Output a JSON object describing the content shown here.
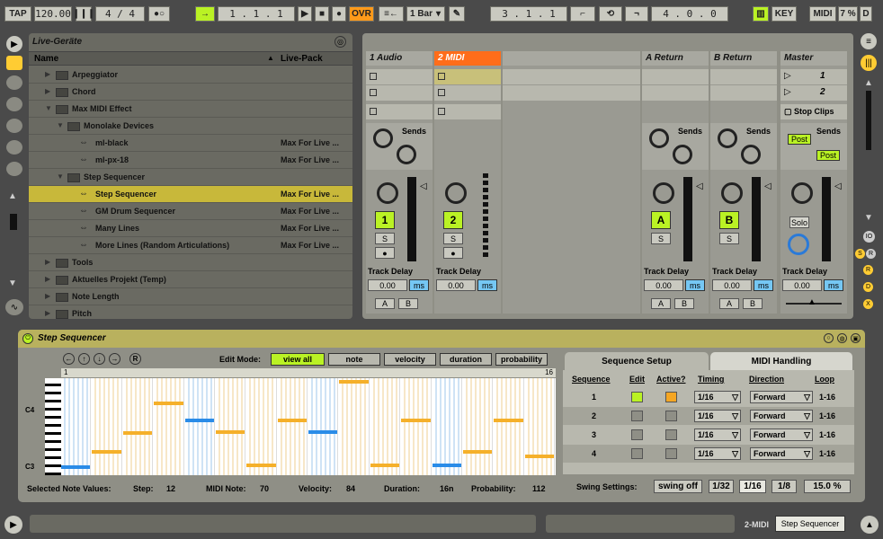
{
  "transport": {
    "tap": "TAP",
    "tempo": "120.00",
    "meter": "4 / 4",
    "position": "1 . 1 . 1",
    "ovr": "OVR",
    "quant": "1 Bar",
    "loop_start": "3 . 1 . 1",
    "loop_len": "4 . 0 . 0",
    "key": "KEY",
    "midi": "MIDI",
    "cpu": "7 %",
    "d": "D"
  },
  "browser": {
    "title": "Live-Geräte",
    "col_name": "Name",
    "col_pack": "Live-Pack",
    "items": [
      {
        "label": "Arpeggiator",
        "pack": ""
      },
      {
        "label": "Chord",
        "pack": ""
      },
      {
        "label": "Max MIDI Effect",
        "pack": ""
      },
      {
        "label": "Monolake Devices",
        "pack": ""
      },
      {
        "label": "ml-black",
        "pack": "Max For Live ..."
      },
      {
        "label": "ml-px-18",
        "pack": "Max For Live ..."
      },
      {
        "label": "Step Sequencer",
        "pack": ""
      },
      {
        "label": "Step Sequencer",
        "pack": "Max For Live ..."
      },
      {
        "label": "GM Drum Sequencer",
        "pack": "Max For Live ..."
      },
      {
        "label": "Many Lines",
        "pack": "Max For Live ..."
      },
      {
        "label": "More Lines (Random Articulations)",
        "pack": "Max For Live ..."
      },
      {
        "label": "Tools",
        "pack": ""
      },
      {
        "label": "Aktuelles Projekt (Temp)",
        "pack": ""
      },
      {
        "label": "Note Length",
        "pack": ""
      },
      {
        "label": "Pitch",
        "pack": ""
      }
    ]
  },
  "mixer": {
    "tracks": [
      {
        "name": "1 Audio",
        "num": "1",
        "delay": "0.00",
        "ms": "ms",
        "solo": "S",
        "sends": "Sends"
      },
      {
        "name": "2 MIDI",
        "num": "2",
        "delay": "0.00",
        "ms": "ms",
        "solo": "S",
        "sends": ""
      },
      {
        "name": "A Return",
        "num": "A",
        "delay": "0.00",
        "ms": "ms",
        "solo": "S",
        "sends": "Sends"
      },
      {
        "name": "B Return",
        "num": "B",
        "delay": "0.00",
        "ms": "ms",
        "solo": "S",
        "sends": "Sends"
      },
      {
        "name": "Master",
        "num": "",
        "delay": "0.00",
        "ms": "ms",
        "solo": "Solo",
        "sends": "Sends"
      }
    ],
    "track_delay": "Track Delay",
    "stop_clips": "Stop Clips",
    "post": "Post",
    "scene1": "1",
    "scene2": "2",
    "a": "A",
    "b": "B"
  },
  "device": {
    "title": "Step Sequencer",
    "edit_mode": "Edit Mode:",
    "modes": [
      "view all",
      "note",
      "velocity",
      "duration",
      "probability"
    ],
    "tab_setup": "Sequence Setup",
    "tab_midi": "MIDI Handling",
    "c4": "C4",
    "c3": "C3",
    "ruler_start": "1",
    "ruler_end": "16",
    "headers": [
      "Sequence",
      "Edit",
      "Active?",
      "Timing",
      "Direction",
      "Loop"
    ],
    "rows": [
      {
        "seq": "1",
        "timing": "1/16",
        "dir": "Forward",
        "loop": "1-16"
      },
      {
        "seq": "2",
        "timing": "1/16",
        "dir": "Forward",
        "loop": "1-16"
      },
      {
        "seq": "3",
        "timing": "1/16",
        "dir": "Forward",
        "loop": "1-16"
      },
      {
        "seq": "4",
        "timing": "1/16",
        "dir": "Forward",
        "loop": "1-16"
      }
    ],
    "selected": "Selected Note Values:",
    "step_l": "Step:",
    "step": "12",
    "note_l": "MIDI Note:",
    "note": "70",
    "vel_l": "Velocity:",
    "vel": "84",
    "dur_l": "Duration:",
    "dur": "16n",
    "prob_l": "Probability:",
    "prob": "112",
    "swing_l": "Swing Settings:",
    "swing_off": "swing off",
    "s32": "1/32",
    "s16": "1/16",
    "s8": "1/8",
    "swing_pct": "15.0 %"
  },
  "status": {
    "track": "2-MIDI",
    "device": "Step Sequencer"
  }
}
